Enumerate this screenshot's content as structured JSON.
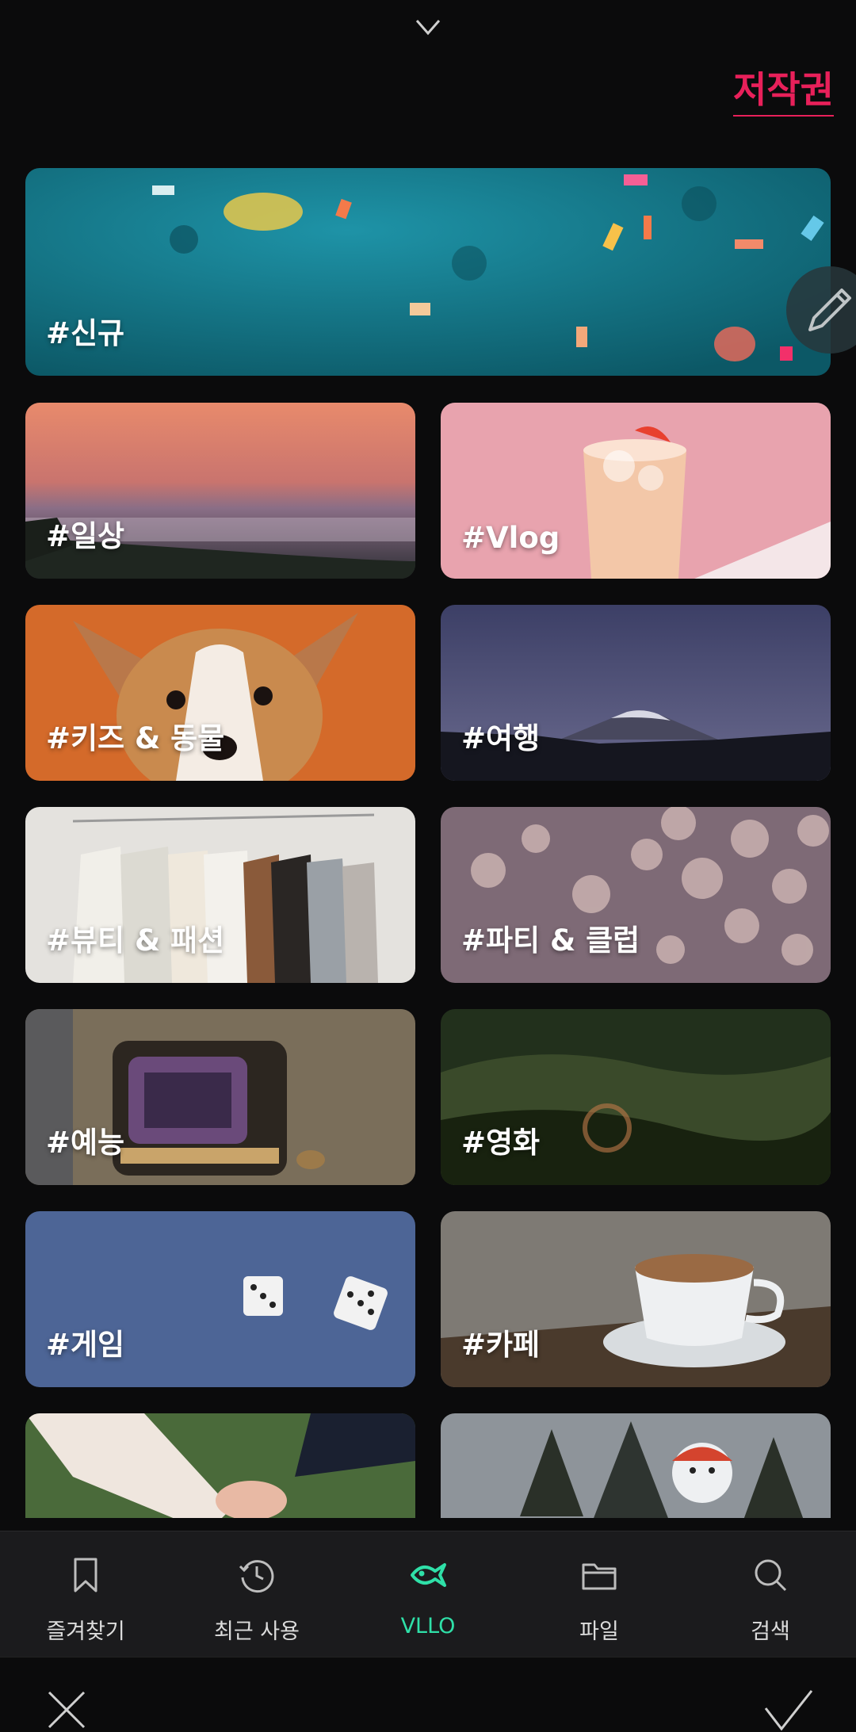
{
  "header": {
    "copyright_label": "저작권"
  },
  "categories": [
    {
      "label": "#신규"
    },
    {
      "label": "#일상"
    },
    {
      "label": "#Vlog"
    },
    {
      "label": "#키즈 & 동물"
    },
    {
      "label": "#여행"
    },
    {
      "label": "#뷰티 & 패션"
    },
    {
      "label": "#파티 & 클럽"
    },
    {
      "label": "#예능"
    },
    {
      "label": "#영화"
    },
    {
      "label": "#게임"
    },
    {
      "label": "#카페"
    }
  ],
  "bottom_nav": [
    {
      "label": "즐겨찾기",
      "icon": "bookmark-icon"
    },
    {
      "label": "최근 사용",
      "icon": "history-icon"
    },
    {
      "label": "VLLO",
      "icon": "vllo-fish-icon",
      "active": true
    },
    {
      "label": "파일",
      "icon": "folder-icon"
    },
    {
      "label": "검색",
      "icon": "search-icon"
    }
  ],
  "colors": {
    "accent": "#2fe0a8",
    "copyright": "#e8205a",
    "background": "#0b0b0c",
    "nav_bg": "#1b1b1d"
  }
}
